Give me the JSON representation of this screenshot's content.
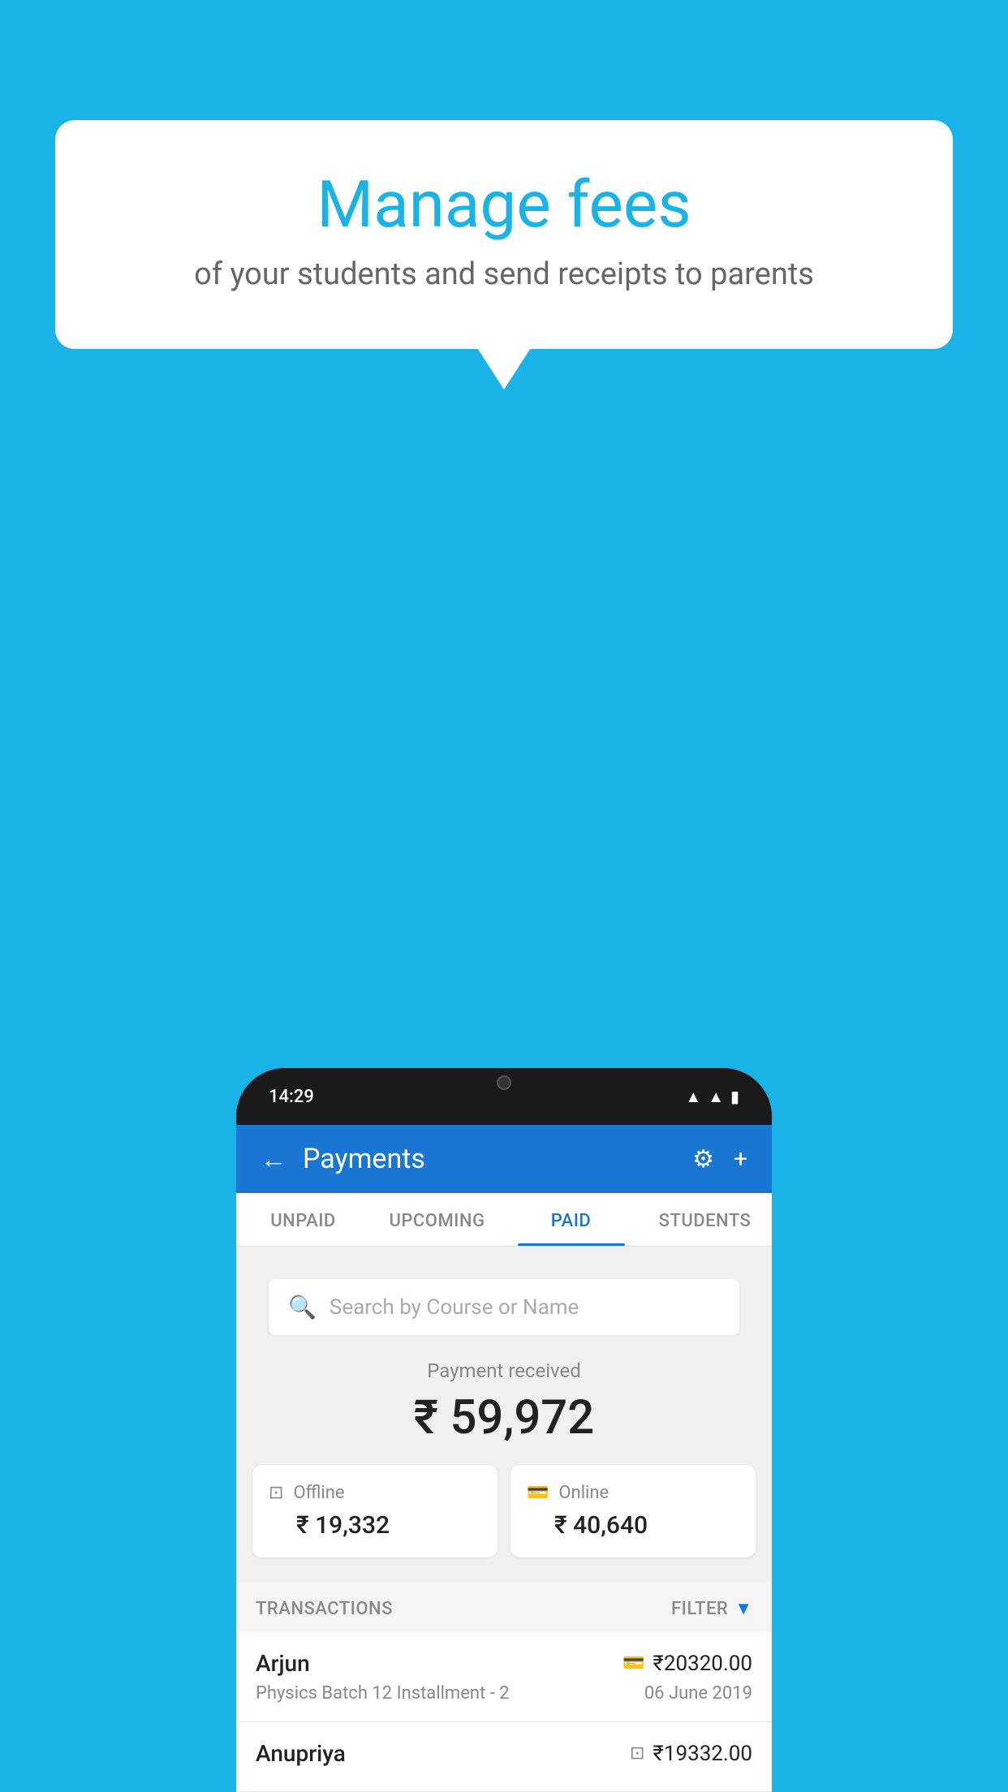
{
  "background_color": "#1ab3e8",
  "speech_bubble": {
    "title": "Manage fees",
    "subtitle": "of your students and send receipts to parents"
  },
  "phone": {
    "status_bar": {
      "time": "14:29"
    },
    "app_header": {
      "title": "Payments",
      "back_label": "←",
      "gear_symbol": "⚙",
      "plus_symbol": "+"
    },
    "tabs": [
      {
        "label": "UNPAID",
        "active": false
      },
      {
        "label": "UPCOMING",
        "active": false
      },
      {
        "label": "PAID",
        "active": true
      },
      {
        "label": "STUDENTS",
        "active": false
      }
    ],
    "search": {
      "placeholder": "Search by Course or Name"
    },
    "payment_summary": {
      "label": "Payment received",
      "total_amount": "₹ 59,972",
      "offline_label": "Offline",
      "offline_amount": "₹ 19,332",
      "online_label": "Online",
      "online_amount": "₹ 40,640"
    },
    "transactions": {
      "header_label": "TRANSACTIONS",
      "filter_label": "FILTER",
      "rows": [
        {
          "name": "Arjun",
          "amount": "₹20320.00",
          "course": "Physics Batch 12 Installment - 2",
          "date": "06 June 2019",
          "payment_type": "online"
        },
        {
          "name": "Anupriya",
          "amount": "₹19332.00",
          "course": "",
          "date": "",
          "payment_type": "offline"
        }
      ]
    }
  }
}
